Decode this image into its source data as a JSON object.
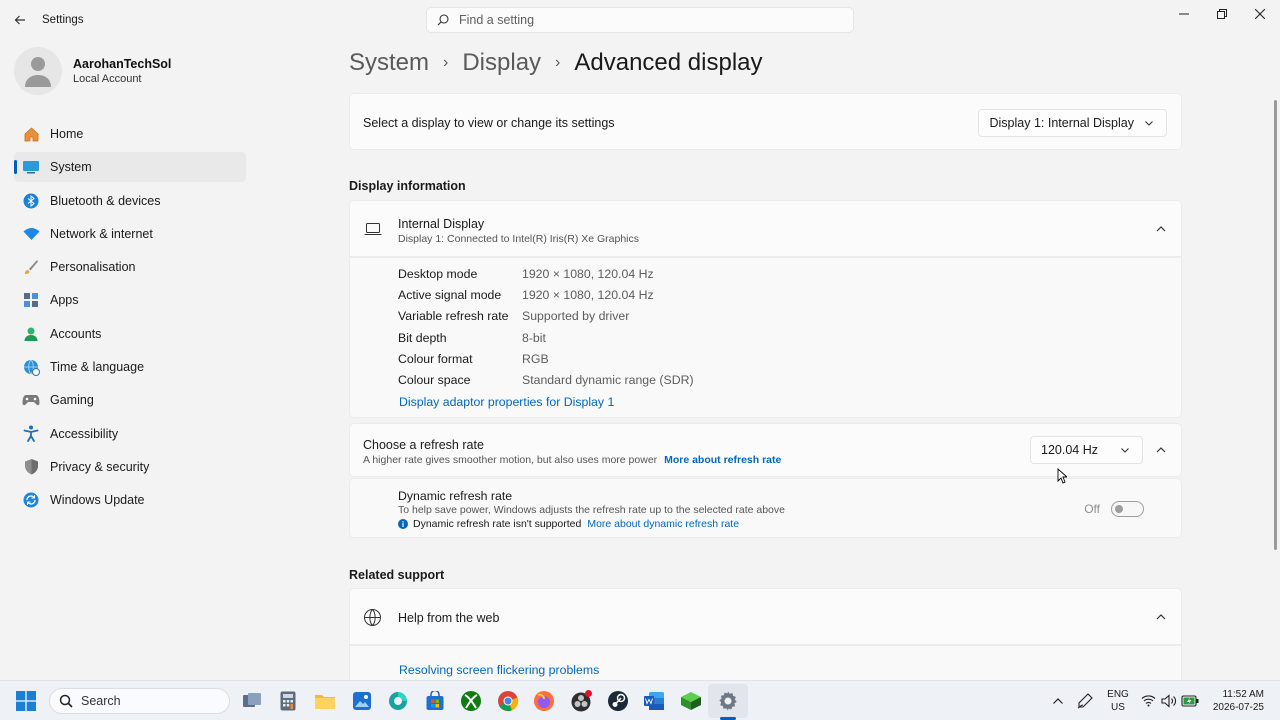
{
  "window": {
    "title": "Settings",
    "search_placeholder": "Find a setting"
  },
  "profile": {
    "name": "AarohanTechSol",
    "account_type": "Local Account"
  },
  "nav": {
    "items": [
      {
        "label": "Home",
        "icon": "home-icon"
      },
      {
        "label": "System",
        "icon": "system-icon"
      },
      {
        "label": "Bluetooth & devices",
        "icon": "bluetooth-icon"
      },
      {
        "label": "Network & internet",
        "icon": "wifi-icon"
      },
      {
        "label": "Personalisation",
        "icon": "brush-icon"
      },
      {
        "label": "Apps",
        "icon": "apps-icon"
      },
      {
        "label": "Accounts",
        "icon": "accounts-icon"
      },
      {
        "label": "Time & language",
        "icon": "globe-clock-icon"
      },
      {
        "label": "Gaming",
        "icon": "gamepad-icon"
      },
      {
        "label": "Accessibility",
        "icon": "accessibility-icon"
      },
      {
        "label": "Privacy & security",
        "icon": "shield-icon"
      },
      {
        "label": "Windows Update",
        "icon": "update-icon"
      }
    ],
    "active_index": 1
  },
  "breadcrumb": {
    "level1": "System",
    "level2": "Display",
    "current": "Advanced display"
  },
  "display_select": {
    "label": "Select a display to view or change its settings",
    "selected": "Display 1: Internal Display"
  },
  "display_info": {
    "section_title": "Display information",
    "title": "Internal Display",
    "subtitle": "Display 1: Connected to Intel(R) Iris(R) Xe Graphics",
    "rows": [
      {
        "key": "Desktop mode",
        "value": "1920 × 1080, 120.04 Hz"
      },
      {
        "key": "Active signal mode",
        "value": "1920 × 1080, 120.04 Hz"
      },
      {
        "key": "Variable refresh rate",
        "value": "Supported by driver"
      },
      {
        "key": "Bit depth",
        "value": "8-bit"
      },
      {
        "key": "Colour format",
        "value": "RGB"
      },
      {
        "key": "Colour space",
        "value": "Standard dynamic range (SDR)"
      }
    ],
    "adaptor_link": "Display adaptor properties for Display 1"
  },
  "refresh_rate": {
    "title": "Choose a refresh rate",
    "subtitle": "A higher rate gives smoother motion, but also uses more power",
    "more_link": "More about refresh rate",
    "selected": "120.04 Hz"
  },
  "dynamic_refresh": {
    "title": "Dynamic refresh rate",
    "subtitle": "To help save power, Windows adjusts the refresh rate up to the selected rate above",
    "note": "Dynamic refresh rate isn't supported",
    "more_link": "More about dynamic refresh rate",
    "toggle_label": "Off"
  },
  "related_support": {
    "section_title": "Related support",
    "help_title": "Help from the web",
    "help_link": "Resolving screen flickering problems"
  },
  "taskbar": {
    "search_placeholder": "Search",
    "lang_line1": "ENG",
    "lang_line2": "US",
    "time": "11:52 AM",
    "date": "2026-07-25"
  },
  "colors": {
    "accent": "#005fb8",
    "link": "#0067c0"
  }
}
